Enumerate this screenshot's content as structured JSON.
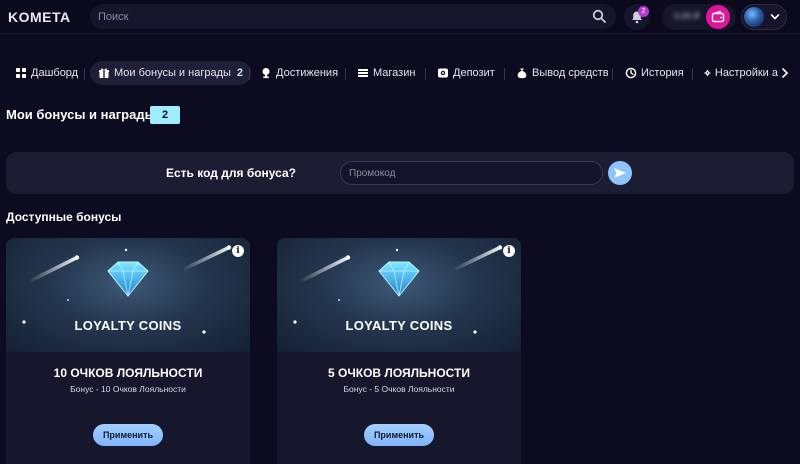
{
  "header": {
    "logo": "KOMETA",
    "search_placeholder": "Поиск",
    "notifications_count": "2",
    "balance": "0,00 ₽"
  },
  "tabs": [
    {
      "label": "Дашборд",
      "icon": "grid-icon"
    },
    {
      "label": "Мои бонусы и награды",
      "icon": "gift-icon",
      "count": "2",
      "active": true
    },
    {
      "label": "Достижения",
      "icon": "trophy-icon"
    },
    {
      "label": "Магазин",
      "icon": "store-icon"
    },
    {
      "label": "Депозит",
      "icon": "deposit-icon"
    },
    {
      "label": "Вывод средств",
      "icon": "money-bag-icon"
    },
    {
      "label": "История",
      "icon": "history-icon"
    },
    {
      "label": "Настройки а",
      "icon": "gear-icon"
    }
  ],
  "page": {
    "title": "Мои бонусы и награды",
    "count": "2"
  },
  "promo": {
    "label": "Есть код для бонуса?",
    "placeholder": "Промокод"
  },
  "section": {
    "title": "Доступные бонусы"
  },
  "cards": [
    {
      "banner_title": "LOYALTY COINS",
      "name": "10 ОЧКОВ ЛОЯЛЬНОСТИ",
      "subtitle": "Бонус - 10 Очков Лояльности",
      "button": "Применить"
    },
    {
      "banner_title": "LOYALTY COINS",
      "name": "5 ОЧКОВ ЛОЯЛЬНОСТИ",
      "subtitle": "Бонус - 5 Очков Лояльности",
      "button": "Применить"
    }
  ],
  "colors": {
    "background": "#0c0b1f",
    "accent_cyan": "#9eeeff",
    "button_blue": "#8cc4ff",
    "wallet_pink": "#e0169a"
  }
}
